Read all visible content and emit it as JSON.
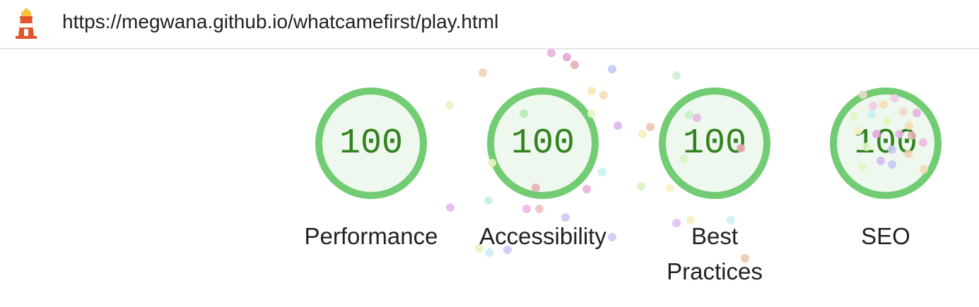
{
  "header": {
    "url": "https://megwana.github.io/whatcamefirst/play.html",
    "logo_icon": "lighthouse-icon"
  },
  "colors": {
    "pass_green": "#32821f",
    "ring_green": "#71cc73",
    "ring_fill": "#eef8ee",
    "logo_orange": "#e0552c",
    "logo_yellow": "#f6c33a"
  },
  "gauges": [
    {
      "id": "performance",
      "score": "100",
      "label": "Performance",
      "value": 100
    },
    {
      "id": "accessibility",
      "score": "100",
      "label": "Accessibility",
      "value": 100
    },
    {
      "id": "best-practices",
      "score": "100",
      "label": "Best Practices",
      "value": 100
    },
    {
      "id": "seo",
      "score": "100",
      "label": "SEO",
      "value": 100
    }
  ]
}
